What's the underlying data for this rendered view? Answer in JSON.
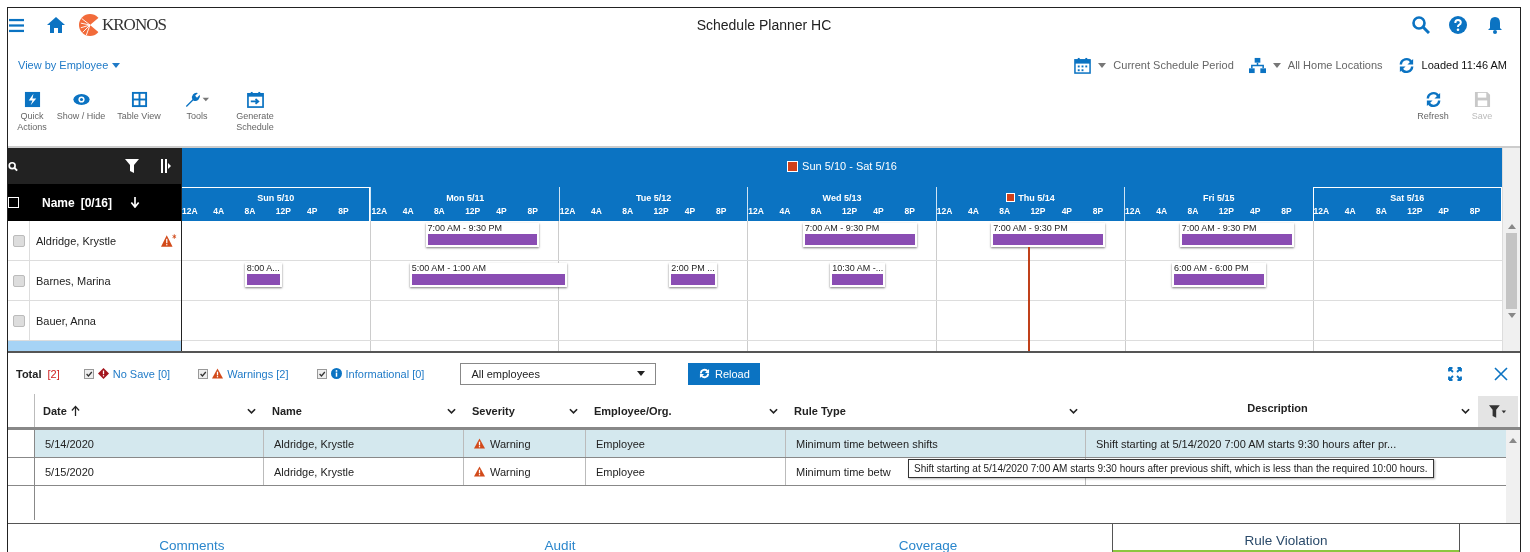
{
  "app_bar": {
    "logo_text": "KRONOS",
    "title": "Schedule Planner HC"
  },
  "view_selector": {
    "label": "View by Employee"
  },
  "context": {
    "period": "Current Schedule Period",
    "locations": "All Home Locations",
    "loaded": "Loaded 11:46 AM"
  },
  "toolbar": [
    {
      "label": "Quick Actions",
      "disabled": false
    },
    {
      "label": "Show / Hide",
      "disabled": false
    },
    {
      "label": "Table View",
      "disabled": false
    },
    {
      "label": "Tools",
      "disabled": false
    },
    {
      "label": "Generate Schedule",
      "disabled": false
    }
  ],
  "toolbar_right": [
    {
      "label": "Refresh",
      "disabled": false
    },
    {
      "label": "Save",
      "disabled": true
    }
  ],
  "schedule": {
    "period_label": "Sun 5/10 - Sat 5/16",
    "name_header": "Name",
    "name_count": "[0/16]",
    "select_all": false,
    "days": [
      {
        "label": "Sun 5/10",
        "weekend": true,
        "today": false,
        "hours": [
          "12A",
          "4A",
          "8A",
          "12P",
          "4P",
          "8P"
        ]
      },
      {
        "label": "Mon 5/11",
        "weekend": false,
        "today": false,
        "hours": [
          "12A",
          "4A",
          "8A",
          "12P",
          "4P",
          "8P"
        ]
      },
      {
        "label": "Tue 5/12",
        "weekend": false,
        "today": false,
        "hours": [
          "12A",
          "4A",
          "8A",
          "12P",
          "4P",
          "8P"
        ]
      },
      {
        "label": "Wed 5/13",
        "weekend": false,
        "today": false,
        "hours": [
          "12A",
          "4A",
          "8A",
          "12P",
          "4P",
          "8P"
        ]
      },
      {
        "label": "Thu 5/14",
        "weekend": false,
        "today": true,
        "hours": [
          "12A",
          "4A",
          "8A",
          "12P",
          "4P",
          "8P"
        ]
      },
      {
        "label": "Fri 5/15",
        "weekend": false,
        "today": false,
        "hours": [
          "12A",
          "4A",
          "8A",
          "12P",
          "4P",
          "8P"
        ]
      },
      {
        "label": "Sat 5/16",
        "weekend": true,
        "today": false,
        "hours": [
          "12A",
          "4A",
          "8A",
          "12P",
          "4P",
          "8P"
        ]
      }
    ],
    "employees": [
      {
        "name": "Aldridge, Krystle",
        "checked": false,
        "warning": true,
        "week": [
          {
            "kind": "empty"
          },
          {
            "kind": "shift",
            "label": "7:00 AM - 9:30 PM"
          },
          {
            "kind": "empty"
          },
          {
            "kind": "shift",
            "label": "7:00 AM - 9:30 PM"
          },
          {
            "kind": "shift",
            "label": "7:00 AM - 9:30 PM"
          },
          {
            "kind": "shift",
            "label": "7:00 AM - 9:30 PM"
          },
          {
            "kind": "empty"
          }
        ]
      },
      {
        "name": "Barnes, Marina",
        "checked": false,
        "warning": false,
        "week": [
          {
            "kind": "shift",
            "label": "8:00 A..."
          },
          {
            "kind": "shift",
            "label": "5:00 AM - 1:00 AM"
          },
          {
            "kind": "shift",
            "label": "2:00 PM ..."
          },
          {
            "kind": "shift",
            "label": "10:30 AM -..."
          },
          {
            "kind": "empty"
          },
          {
            "kind": "shift",
            "label": "6:00 AM - 6:00 PM"
          },
          {
            "kind": "empty"
          }
        ]
      },
      {
        "name": "Bauer, Anna",
        "checked": false,
        "warning": false,
        "week": [
          {
            "kind": "empty"
          },
          {
            "kind": "empty"
          },
          {
            "kind": "empty"
          },
          {
            "kind": "empty"
          },
          {
            "kind": "empty"
          },
          {
            "kind": "empty"
          },
          {
            "kind": "empty"
          }
        ]
      }
    ],
    "clipped_row": {
      "selected": true
    }
  },
  "violations": {
    "total_label": "Total",
    "total_count": "[2]",
    "filters": [
      {
        "kind": "no_save",
        "label": "No Save",
        "count": "[0]",
        "checked": true
      },
      {
        "kind": "warning",
        "label": "Warnings",
        "count": "[2]",
        "checked": true
      },
      {
        "kind": "info",
        "label": "Informational",
        "count": "[0]",
        "checked": true
      }
    ],
    "employee_filter": "All employees",
    "reload": "Reload",
    "columns": [
      {
        "label": "Date",
        "sorted": true
      },
      {
        "label": "Name",
        "sorted": false
      },
      {
        "label": "Severity",
        "sorted": false
      },
      {
        "label": "Employee/Org.",
        "sorted": false
      },
      {
        "label": "Rule Type",
        "sorted": false
      },
      {
        "label": "Description",
        "sorted": false
      }
    ],
    "rows": [
      {
        "selected": true,
        "date": "5/14/2020",
        "name": "Aldridge, Krystle",
        "severity": {
          "kind": "warning",
          "label": "Warning"
        },
        "org": "Employee",
        "rule_type": "Minimum time between shifts",
        "description": "Shift starting at 5/14/2020 7:00 AM starts 9:30 hours after pr..."
      },
      {
        "selected": false,
        "date": "5/15/2020",
        "name": "Aldridge, Krystle",
        "severity": {
          "kind": "warning",
          "label": "Warning"
        },
        "org": "Employee",
        "rule_type": "Minimum time betw"
      }
    ],
    "tooltip": "Shift starting at 5/14/2020 7:00 AM starts 9:30 hours after previous shift, which is less than the required 10:00 hours."
  },
  "tabs": [
    {
      "label": "Comments",
      "selected": false
    },
    {
      "label": "Audit",
      "selected": false
    },
    {
      "label": "Coverage",
      "selected": false
    },
    {
      "label": "Rule Violation",
      "selected": true
    }
  ]
}
